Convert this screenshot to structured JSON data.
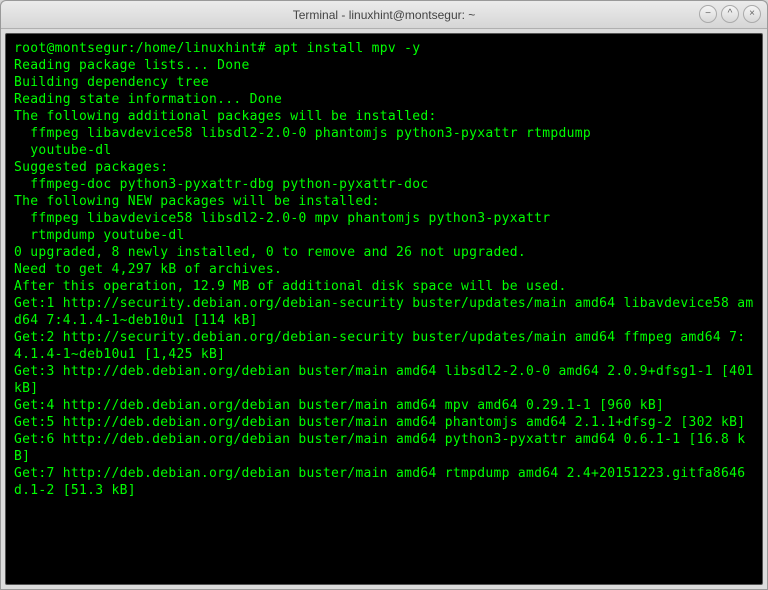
{
  "window": {
    "title": "Terminal - linuxhint@montsegur: ~",
    "controls": {
      "minimize": "−",
      "maximize": "^",
      "close": "×"
    }
  },
  "terminal": {
    "prompt": "root@montsegur:/home/linuxhint#",
    "command": "apt install mpv -y",
    "lines": [
      "Reading package lists... Done",
      "Building dependency tree",
      "Reading state information... Done",
      "The following additional packages will be installed:",
      "  ffmpeg libavdevice58 libsdl2-2.0-0 phantomjs python3-pyxattr rtmpdump",
      "  youtube-dl",
      "Suggested packages:",
      "  ffmpeg-doc python3-pyxattr-dbg python-pyxattr-doc",
      "The following NEW packages will be installed:",
      "  ffmpeg libavdevice58 libsdl2-2.0-0 mpv phantomjs python3-pyxattr",
      "  rtmpdump youtube-dl",
      "0 upgraded, 8 newly installed, 0 to remove and 26 not upgraded.",
      "Need to get 4,297 kB of archives.",
      "After this operation, 12.9 MB of additional disk space will be used.",
      "Get:1 http://security.debian.org/debian-security buster/updates/main amd64 libavdevice58 amd64 7:4.1.4-1~deb10u1 [114 kB]",
      "Get:2 http://security.debian.org/debian-security buster/updates/main amd64 ffmpeg amd64 7:4.1.4-1~deb10u1 [1,425 kB]",
      "Get:3 http://deb.debian.org/debian buster/main amd64 libsdl2-2.0-0 amd64 2.0.9+dfsg1-1 [401 kB]",
      "Get:4 http://deb.debian.org/debian buster/main amd64 mpv amd64 0.29.1-1 [960 kB]",
      "Get:5 http://deb.debian.org/debian buster/main amd64 phantomjs amd64 2.1.1+dfsg-2 [302 kB]",
      "Get:6 http://deb.debian.org/debian buster/main amd64 python3-pyxattr amd64 0.6.1-1 [16.8 kB]",
      "Get:7 http://deb.debian.org/debian buster/main amd64 rtmpdump amd64 2.4+20151223.gitfa8646d.1-2 [51.3 kB]"
    ]
  }
}
